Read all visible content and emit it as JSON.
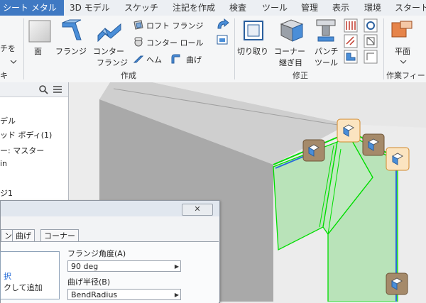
{
  "tabs": [
    {
      "label": "シート メタル",
      "active": true
    },
    {
      "label": "3D モデル"
    },
    {
      "label": "スケッチ"
    },
    {
      "label": "注記を作成"
    },
    {
      "label": "検査"
    },
    {
      "label": "ツール"
    },
    {
      "label": "管理"
    },
    {
      "label": "表示"
    },
    {
      "label": "環境"
    },
    {
      "label": "スタート"
    }
  ],
  "ribbon": {
    "left_partial": {
      "label1": "チを",
      "label2": "キ"
    },
    "create": {
      "face": "面",
      "flange": "フランジ",
      "contour_flange_l1": "コンター",
      "contour_flange_l2": "フランジ",
      "loft_flange": "ロフト フランジ",
      "contour_roll": "コンター ロール",
      "hem": "ヘム",
      "bend": "曲げ",
      "group": "作成"
    },
    "modify": {
      "cut": "切り取り",
      "corner_seam_l1": "コーナー",
      "corner_seam_l2": "継ぎ目",
      "punch_l1": "パンチ",
      "punch_l2": "ツール",
      "group": "修正"
    },
    "flat_pattern": {
      "label": "平面",
      "group": "作業フィー"
    }
  },
  "browser": {
    "items": [
      "デル",
      "ッド ボディ(1)",
      "ー: マスター",
      "in",
      "ジ1"
    ]
  },
  "dialog": {
    "close": "✕",
    "tabs": [
      "ン",
      "曲げ",
      "コーナー"
    ],
    "flange_angle_label": "フランジ角度(A)",
    "flange_angle_value": "90 deg",
    "bend_radius_label": "曲げ半径(B)",
    "bend_radius_value": "BendRadius",
    "select_text": "択",
    "add_text": "クして追加"
  },
  "colors": {
    "accent_tab": "#3f79c3",
    "highlight": "#00dd00",
    "face_fill": "#a8e0a8",
    "glyph_box": "#a58a6a"
  }
}
